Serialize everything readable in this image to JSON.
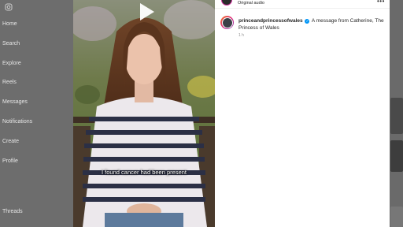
{
  "sidebar": {
    "logo_icon": "instagram-glyph-icon",
    "items": [
      {
        "label": "Home"
      },
      {
        "label": "Search"
      },
      {
        "label": "Explore"
      },
      {
        "label": "Reels"
      },
      {
        "label": "Messages"
      },
      {
        "label": "Notifications"
      },
      {
        "label": "Create"
      },
      {
        "label": "Profile"
      },
      {
        "label": "Threads"
      }
    ]
  },
  "post": {
    "audio_label": "Original audio",
    "more_icon": "more-options-icon",
    "comment": {
      "username": "princeandprincessofwales",
      "verified_icon": "verified-badge-icon",
      "text": " A message from Catherine, The Princess of Wales",
      "time": "1 h"
    }
  },
  "video": {
    "caption": "I found cancer had been present",
    "play_icon": "play-icon"
  },
  "colors": {
    "overlay": "#6d6d6d",
    "panel": "#ffffff",
    "verified": "#0095f6",
    "text": "#262626",
    "muted": "#8e8e8e"
  }
}
